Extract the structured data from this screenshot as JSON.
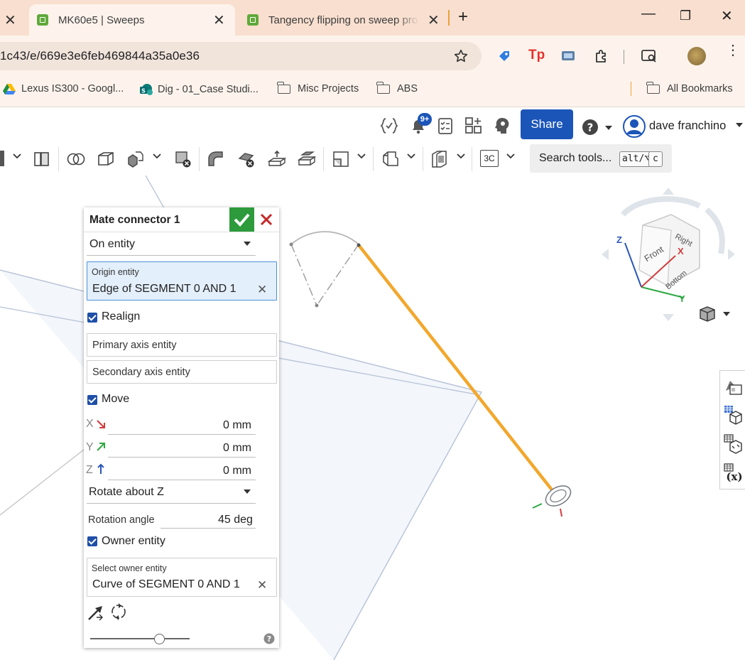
{
  "browser": {
    "tabs": [
      {
        "title": "MK60e5 | Sweeps",
        "active": true
      },
      {
        "title": "Tangency flipping on sweep pro",
        "active": false
      }
    ],
    "new_tab": "+",
    "close_glyph": "✕",
    "window": {
      "minimize": "—",
      "restore": "❐",
      "close": "✕"
    },
    "url": "1c43/e/669e3e6feb469844a35a0e36",
    "bookmarks": [
      {
        "label": "Lexus IS300 - Googl...",
        "icon": "google-drive-icon"
      },
      {
        "label": "Dig - 01_Case Studi...",
        "icon": "sharepoint-icon"
      },
      {
        "label": "Misc Projects",
        "icon": "folder-icon"
      },
      {
        "label": "ABS",
        "icon": "folder-icon"
      }
    ],
    "all_bookmarks": "All Bookmarks",
    "colors": {
      "tab_strip": "#f8dfcf",
      "toolbar": "#fdf3ec"
    }
  },
  "header": {
    "notification_badge": "9+",
    "share_label": "Share",
    "user_name": "dave franchino",
    "colors": {
      "share": "#1b55b8"
    }
  },
  "toolbar": {
    "search_label": "Search tools...",
    "shortcut_key1": "alt/⌥",
    "shortcut_key2": "c",
    "text_tool_label": "3C"
  },
  "panel": {
    "title": "Mate connector 1",
    "mode": "On entity",
    "origin_label": "Origin entity",
    "origin_value": "Edge of SEGMENT 0 AND 1",
    "realign_label": "Realign",
    "primary_placeholder": "Primary axis entity",
    "secondary_placeholder": "Secondary axis entity",
    "move_label": "Move",
    "x_label": "X",
    "x_value": "0 mm",
    "y_label": "Y",
    "y_value": "0 mm",
    "z_label": "Z",
    "z_value": "0 mm",
    "rotate_mode": "Rotate about Z",
    "rotation_label": "Rotation angle",
    "rotation_value": "45 deg",
    "owner_label": "Owner entity",
    "owner_field_label": "Select owner entity",
    "owner_value": "Curve of SEGMENT 0 AND 1",
    "clear_glyph": "✕",
    "help_glyph": "?",
    "slider_fraction": 0.7,
    "checks": {
      "realign": true,
      "move": true,
      "owner": true
    }
  },
  "view_cube": {
    "faces": [
      "Front",
      "Right",
      "Bottom"
    ],
    "axes": {
      "x": "X",
      "y": "Y",
      "z": "Z"
    }
  },
  "colors": {
    "sweep_path": "#f2a72c",
    "ok": "#2d9b3b",
    "cancel": "#c62828",
    "selection": "#e3effb"
  }
}
